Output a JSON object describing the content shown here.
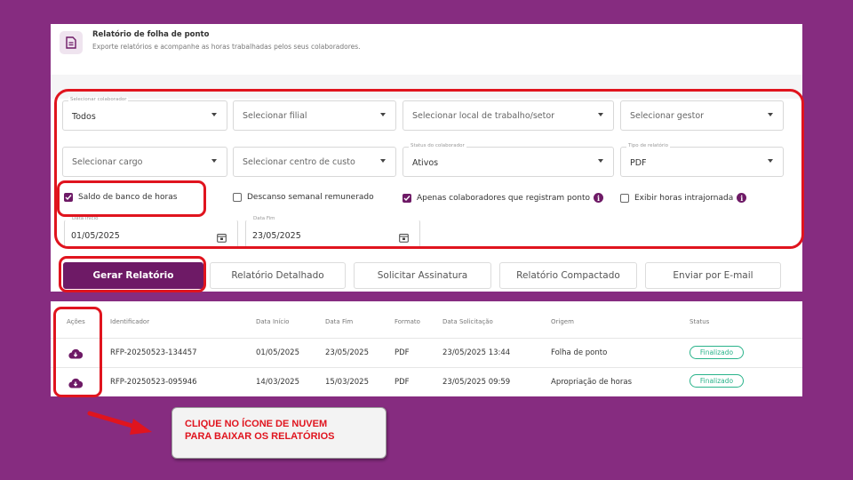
{
  "header": {
    "title": "Relatório de folha de ponto",
    "subtitle": "Exporte relatórios e acompanhe as horas trabalhadas pelos seus colaboradores."
  },
  "filters": {
    "colaborador": {
      "label": "Selecionar colaborador",
      "value": "Todos"
    },
    "filial": {
      "placeholder": "Selecionar filial"
    },
    "local": {
      "placeholder": "Selecionar local de trabalho/setor"
    },
    "gestor": {
      "placeholder": "Selecionar gestor"
    },
    "cargo": {
      "placeholder": "Selecionar cargo"
    },
    "centro_custo": {
      "placeholder": "Selecionar centro de custo"
    },
    "status": {
      "label": "Status do colaborador",
      "value": "Ativos"
    },
    "tipo": {
      "label": "Tipo de relatório",
      "value": "PDF"
    },
    "data_inicio": {
      "label": "Data Início",
      "value": "01/05/2025"
    },
    "data_fim": {
      "label": "Data Fim",
      "value": "23/05/2025"
    }
  },
  "options": {
    "banco_horas": {
      "label": "Saldo de banco de horas",
      "checked": true
    },
    "descanso": {
      "label": "Descanso semanal remunerado",
      "checked": false
    },
    "registram_ponto": {
      "label": "Apenas colaboradores que registram ponto",
      "checked": true
    },
    "intrajornada": {
      "label": "Exibir horas intrajornada",
      "checked": false
    }
  },
  "buttons": {
    "gerar": "Gerar Relatório",
    "detalhado": "Relatório Detalhado",
    "assinatura": "Solicitar Assinatura",
    "compactado": "Relatório Compactado",
    "email": "Enviar por E-mail"
  },
  "table": {
    "headers": [
      "Ações",
      "Identificador",
      "Data Início",
      "Data Fim",
      "Formato",
      "Data Solicitação",
      "Origem",
      "Status"
    ],
    "rows": [
      {
        "id": "RFP-20250523-134457",
        "inicio": "01/05/2025",
        "fim": "23/05/2025",
        "formato": "PDF",
        "solicitacao": "23/05/2025 13:44",
        "origem": "Folha de ponto",
        "status": "Finalizado"
      },
      {
        "id": "RFP-20250523-095946",
        "inicio": "14/03/2025",
        "fim": "15/03/2025",
        "formato": "PDF",
        "solicitacao": "23/05/2025 09:59",
        "origem": "Apropriação de horas",
        "status": "Finalizado"
      }
    ]
  },
  "callout": {
    "line1": "CLIQUE NO ÍCONE DE NUVEM",
    "line2": "PARA BAIXAR OS RELATÓRIOS"
  },
  "colors": {
    "background": "#862c80",
    "primary": "#6e1a66",
    "highlight": "#e0141e",
    "success": "#29b38a"
  }
}
